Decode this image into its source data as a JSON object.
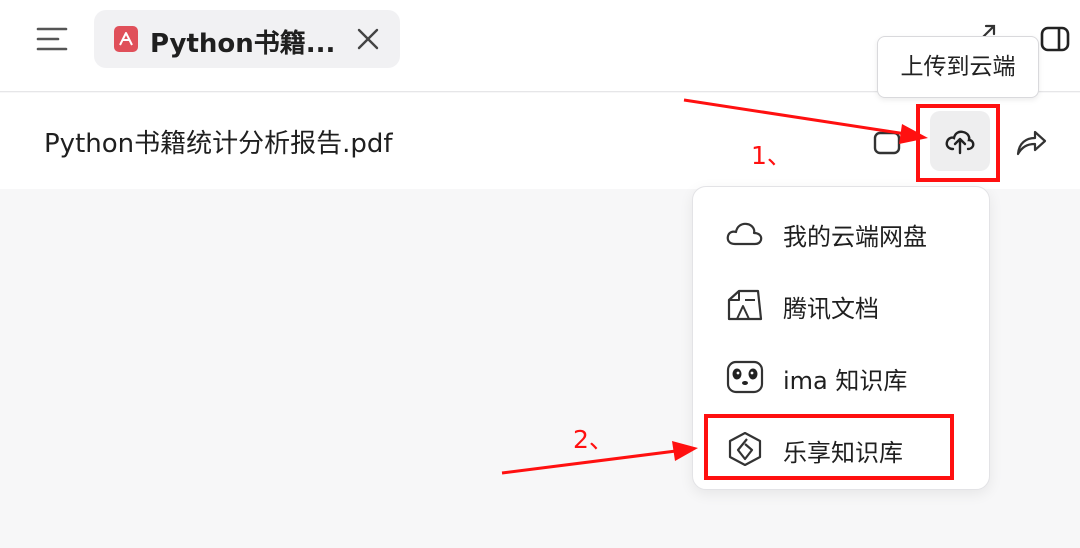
{
  "tab": {
    "title": "Python书籍..."
  },
  "tooltip": {
    "text": "上传到云端"
  },
  "document": {
    "title": "Python书籍统计分析报告.pdf"
  },
  "dropdown": {
    "items": [
      {
        "label": "我的云端网盘",
        "icon": "cloud-icon"
      },
      {
        "label": "腾讯文档",
        "icon": "tencent-docs-icon"
      },
      {
        "label": "ima 知识库",
        "icon": "panda-icon"
      },
      {
        "label": "乐享知识库",
        "icon": "lexiang-icon"
      }
    ]
  },
  "annotations": {
    "step1": "1、",
    "step2": "2、"
  },
  "colors": {
    "annotation_red": "#ff1010",
    "pdf_icon": "#e0505a"
  }
}
